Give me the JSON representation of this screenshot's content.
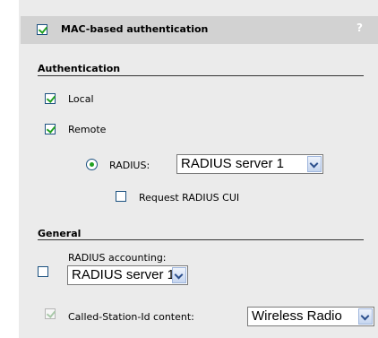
{
  "header": {
    "checkbox_label": "MAC-based authentication",
    "help_label": "?"
  },
  "authentication": {
    "title": "Authentication",
    "local_label": "Local",
    "remote_label": "Remote",
    "radius_label": "RADIUS:",
    "radius_server": "RADIUS server 1",
    "request_cui_label": "Request RADIUS CUI"
  },
  "general": {
    "title": "General",
    "accounting_label": "RADIUS accounting:",
    "accounting_server": "RADIUS server 1",
    "called_station_label": "Called-Station-Id content:",
    "called_station_value": "Wireless Radio"
  }
}
